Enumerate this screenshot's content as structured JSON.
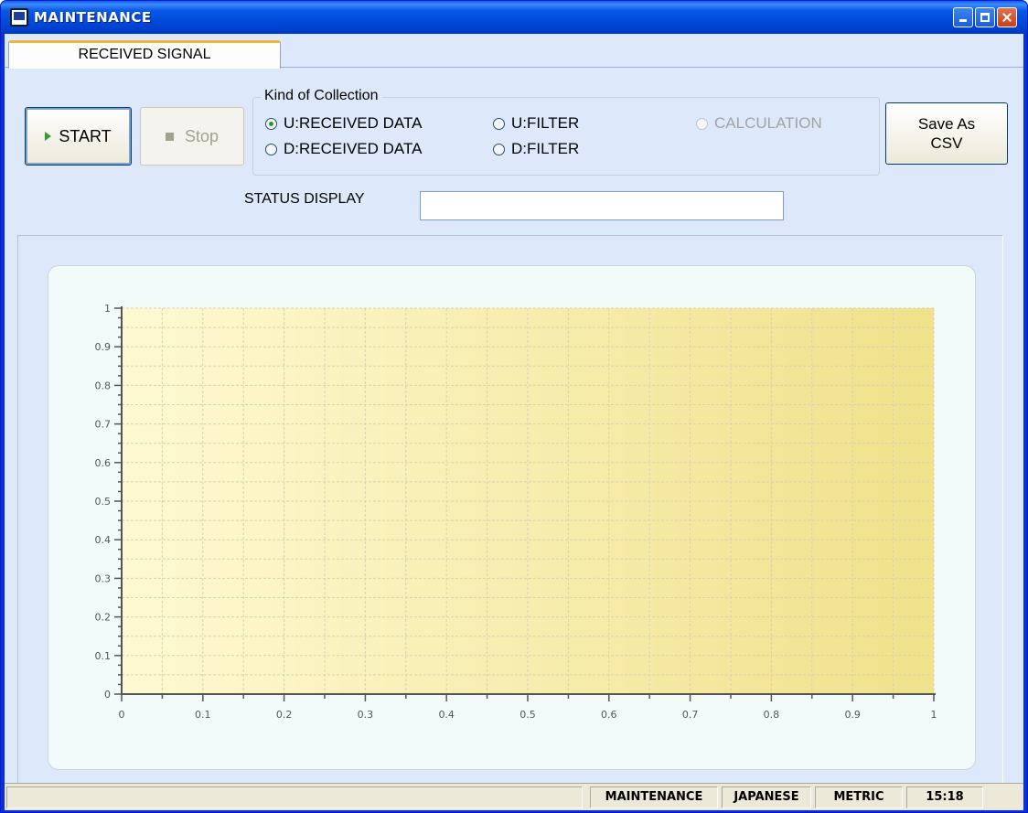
{
  "window": {
    "title": "MAINTENANCE"
  },
  "tabs": [
    {
      "label": "RECEIVED SIGNAL",
      "active": true
    }
  ],
  "toolbar": {
    "start_label": "START",
    "stop_label": "Stop",
    "save_label_line1": "Save As",
    "save_label_line2": "CSV"
  },
  "collection": {
    "legend": "Kind of Collection",
    "options": [
      {
        "label": "U:RECEIVED DATA",
        "selected": true,
        "enabled": true
      },
      {
        "label": "D:RECEIVED DATA",
        "selected": false,
        "enabled": true
      },
      {
        "label": "U:FILTER",
        "selected": false,
        "enabled": true
      },
      {
        "label": "D:FILTER",
        "selected": false,
        "enabled": true
      },
      {
        "label": "CALCULATION",
        "selected": false,
        "enabled": false
      }
    ]
  },
  "status": {
    "label": "STATUS DISPLAY",
    "value": ""
  },
  "chart_data": {
    "type": "line",
    "series": [],
    "xlim": [
      0,
      1
    ],
    "ylim": [
      0,
      1
    ],
    "x_ticks": [
      "0",
      "0.1",
      "0.2",
      "0.3",
      "0.4",
      "0.5",
      "0.6",
      "0.7",
      "0.8",
      "0.9",
      "1"
    ],
    "y_ticks": [
      "0",
      "0.1",
      "0.2",
      "0.3",
      "0.4",
      "0.5",
      "0.6",
      "0.7",
      "0.8",
      "0.9",
      "1"
    ],
    "grid": true,
    "plot_background": [
      "#fef9d2",
      "#f0e18a"
    ]
  },
  "statusbar": {
    "cells": [
      "",
      "MAINTENANCE",
      "JAPANESE",
      "METRIC",
      "15:18"
    ]
  },
  "colors": {
    "titlebar": "#0047d5",
    "client_background": "#dde9fa",
    "tab_highlight": "#f0b43c",
    "radio_selected": "#21a121"
  }
}
